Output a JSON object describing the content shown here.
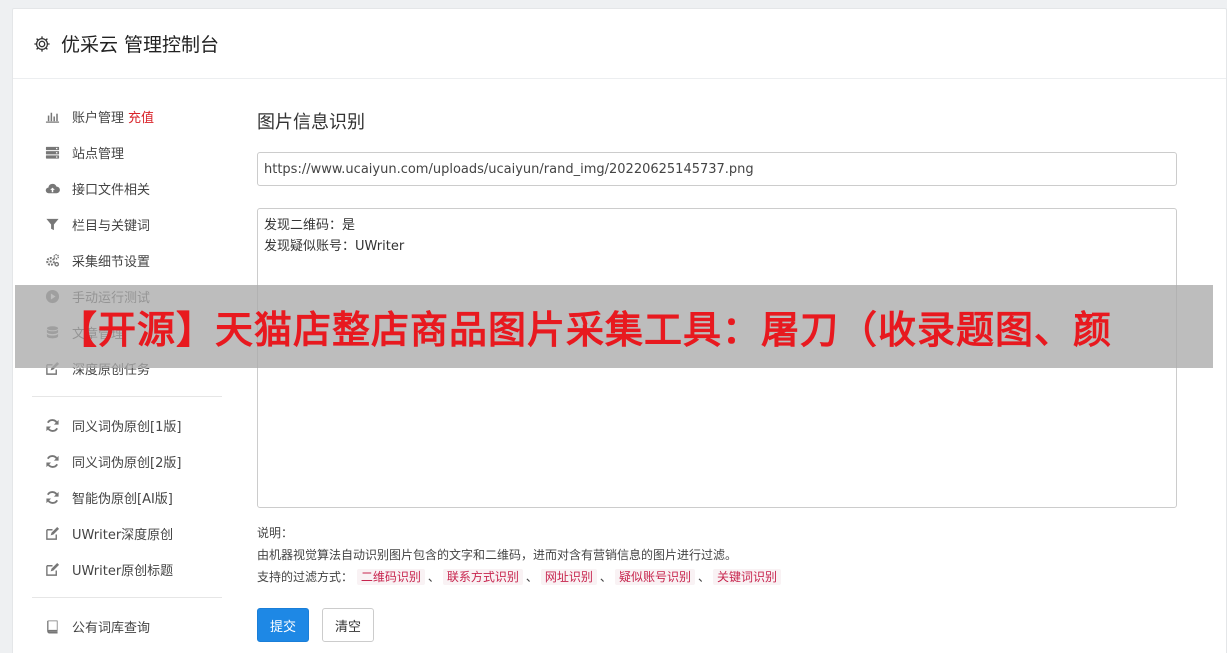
{
  "header": {
    "title": "优采云 管理控制台",
    "icon": "gear-icon"
  },
  "sidebar": {
    "groups": [
      [
        {
          "label": "账户管理",
          "badge": "充值",
          "icon": "bar-chart-icon"
        },
        {
          "label": "站点管理",
          "icon": "server-icon"
        },
        {
          "label": "接口文件相关",
          "icon": "cloud-upload-icon"
        },
        {
          "label": "栏目与关键词",
          "icon": "filter-icon"
        },
        {
          "label": "采集细节设置",
          "icon": "gears-icon"
        },
        {
          "label": "手动运行测试",
          "icon": "play-icon"
        },
        {
          "label": "文章管理",
          "icon": "database-icon"
        },
        {
          "label": "深度原创任务",
          "icon": "edit-icon"
        }
      ],
      [
        {
          "label": "同义词伪原创[1版]",
          "icon": "refresh-icon"
        },
        {
          "label": "同义词伪原创[2版]",
          "icon": "refresh-icon"
        },
        {
          "label": "智能伪原创[AI版]",
          "icon": "refresh-icon"
        },
        {
          "label": "UWriter深度原创",
          "icon": "edit-icon"
        },
        {
          "label": "UWriter原创标题",
          "icon": "edit-icon"
        }
      ],
      [
        {
          "label": "公有词库查询",
          "icon": "book-icon"
        }
      ]
    ]
  },
  "main": {
    "title": "图片信息识别",
    "url_value": "https://www.ucaiyun.com/uploads/ucaiyun/rand_img/20220625145737.png",
    "result_lines": [
      "发现二维码：是",
      "发现疑似账号：UWriter"
    ],
    "notes": {
      "label": "说明：",
      "description": "由机器视觉算法自动识别图片包含的文字和二维码，进而对含有营销信息的图片进行过滤。",
      "filter_prefix": "支持的过滤方式：",
      "filters": [
        "二维码识别",
        "联系方式识别",
        "网址识别",
        "疑似账号识别",
        "关键词识别"
      ],
      "separator": "、"
    },
    "submit_label": "提交",
    "clear_label": "清空"
  },
  "overlay": {
    "text": "【开源】天猫店整店商品图片采集工具：屠刀（收录题图、颜"
  },
  "colors": {
    "accent": "#1e88e5",
    "recharge": "#d9232a",
    "tag_text": "#c7254e",
    "tag_bg": "#f9f2f4",
    "overlay_text": "#e8191f"
  }
}
